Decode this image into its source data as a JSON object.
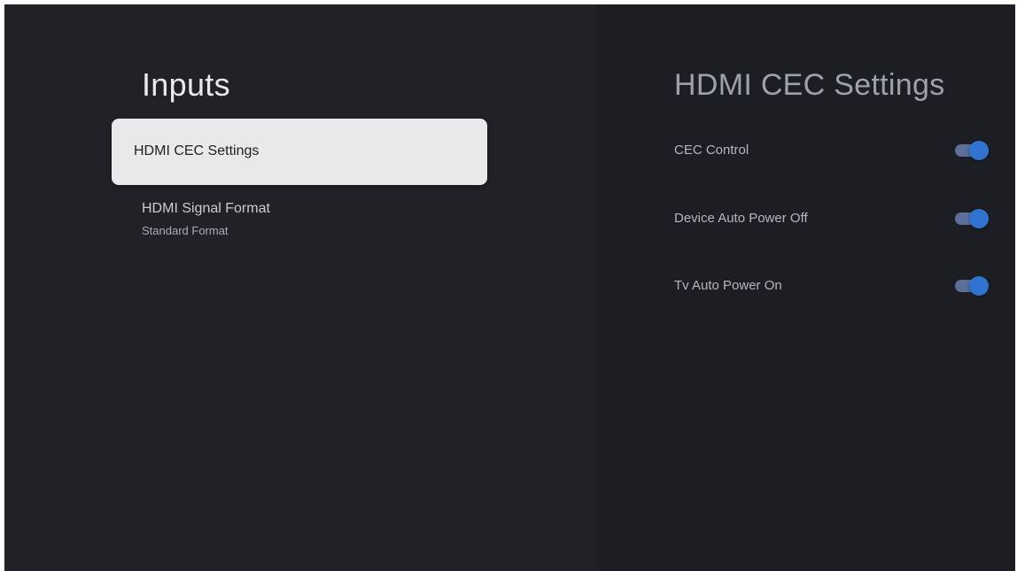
{
  "left_panel": {
    "title": "Inputs",
    "items": [
      {
        "label": "HDMI CEC Settings",
        "sublabel": "",
        "focused": true
      },
      {
        "label": "HDMI Signal Format",
        "sublabel": "Standard Format",
        "focused": false
      }
    ]
  },
  "right_panel": {
    "title": "HDMI CEC Settings",
    "toggles": [
      {
        "label": "CEC Control",
        "state": "on"
      },
      {
        "label": "Device Auto Power Off",
        "state": "on"
      },
      {
        "label": "Tv Auto Power On",
        "state": "on"
      }
    ]
  },
  "colors": {
    "background": "#202227",
    "right_panel_background": "#1c1e23",
    "focused_item": "#e8e9eb",
    "toggle_thumb": "#2f74d0",
    "toggle_track": "#5b6f99"
  }
}
